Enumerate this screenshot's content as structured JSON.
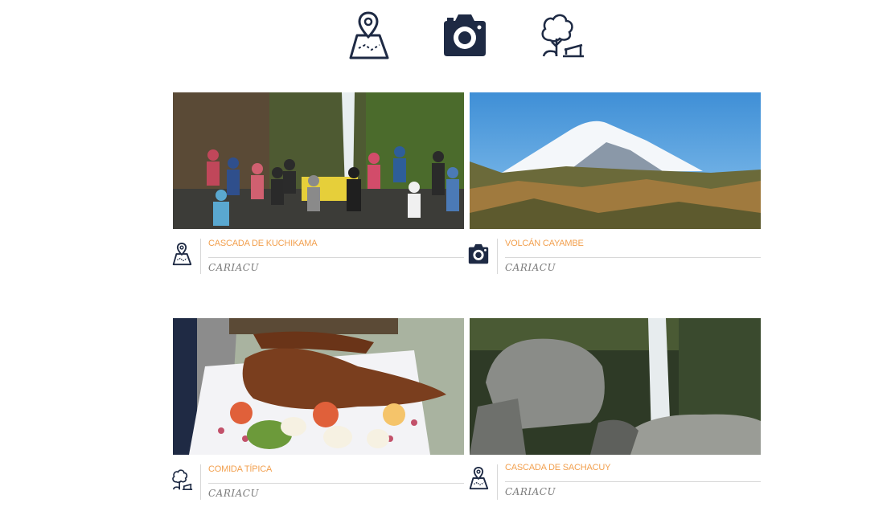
{
  "nav": {
    "icons": [
      "map-pin-icon",
      "camera-icon",
      "tree-bench-icon"
    ]
  },
  "colors": {
    "icon_navy": "#1e2a44",
    "title_orange": "#f2a04f",
    "subtitle_gray": "#7b7b7b"
  },
  "cards": [
    {
      "title": "CASCADA DE KUCHIKAMA",
      "subtitle": "CARIACU",
      "icon": "map-pin-icon",
      "photo": "group-at-waterfall-photo"
    },
    {
      "title": "VOLCÁN CAYAMBE",
      "subtitle": "CARIACU",
      "icon": "camera-icon",
      "photo": "snow-volcano-photo"
    },
    {
      "title": "COMIDA TÍPICA",
      "subtitle": "CARIACU",
      "icon": "tree-bench-icon",
      "photo": "roasted-cuy-photo"
    },
    {
      "title": "CASCADA DE SACHACUY",
      "subtitle": "CARIACU",
      "icon": "map-pin-icon",
      "photo": "waterfall-rocks-photo"
    }
  ]
}
